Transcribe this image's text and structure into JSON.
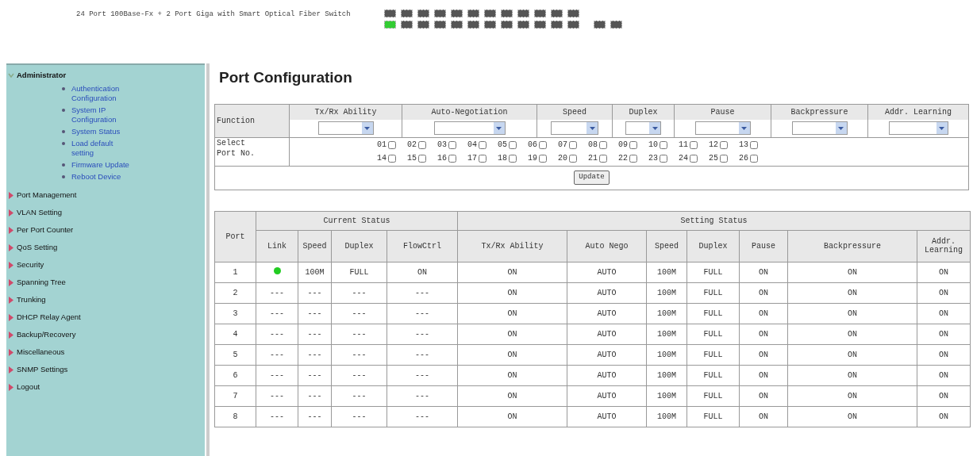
{
  "header": {
    "title": "24 Port 100Base-Fx + 2 Port Giga with Smart Optical Fiber Switch",
    "port_leds_top": [
      {
        "on": false
      },
      {
        "on": false
      },
      {
        "on": false
      },
      {
        "on": false
      },
      {
        "on": false
      },
      {
        "on": false
      },
      {
        "on": false
      },
      {
        "on": false
      },
      {
        "on": false
      },
      {
        "on": false
      },
      {
        "on": false
      },
      {
        "on": false
      }
    ],
    "port_leds_bottom": [
      {
        "on": true
      },
      {
        "on": false
      },
      {
        "on": false
      },
      {
        "on": false
      },
      {
        "on": false
      },
      {
        "on": false
      },
      {
        "on": false
      },
      {
        "on": false
      },
      {
        "on": false
      },
      {
        "on": false
      },
      {
        "on": false
      },
      {
        "on": false
      }
    ],
    "uplink_leds": [
      {
        "on": false
      },
      {
        "on": false
      }
    ]
  },
  "sidebar": {
    "items": [
      {
        "label": "Administrator",
        "expanded": true,
        "children": [
          {
            "label": "Authentication Configuration"
          },
          {
            "label": "System IP Configuration"
          },
          {
            "label": "System Status"
          },
          {
            "label": "Load default setting"
          },
          {
            "label": "Firmware Update"
          },
          {
            "label": "Reboot Device"
          }
        ]
      },
      {
        "label": "Port Management",
        "expanded": false
      },
      {
        "label": "VLAN Setting",
        "expanded": false
      },
      {
        "label": "Per Port Counter",
        "expanded": false
      },
      {
        "label": "QoS Setting",
        "expanded": false
      },
      {
        "label": "Security",
        "expanded": false
      },
      {
        "label": "Spanning Tree",
        "expanded": false
      },
      {
        "label": "Trunking",
        "expanded": false
      },
      {
        "label": "DHCP Relay Agent",
        "expanded": false
      },
      {
        "label": "Backup/Recovery",
        "expanded": false
      },
      {
        "label": "Miscellaneous",
        "expanded": false
      },
      {
        "label": "SNMP Settings",
        "expanded": false
      },
      {
        "label": "Logout",
        "expanded": false
      }
    ]
  },
  "page_title": "Port Configuration",
  "config": {
    "function_label": "Function",
    "columns": [
      "Tx/Rx Ability",
      "Auto-Negotiation",
      "Speed",
      "Duplex",
      "Pause",
      "Backpressure",
      "Addr. Learning"
    ],
    "select_label": "Select Port No.",
    "ports": [
      {
        "label": "01",
        "checked": false
      },
      {
        "label": "02",
        "checked": false
      },
      {
        "label": "03",
        "checked": false
      },
      {
        "label": "04",
        "checked": false
      },
      {
        "label": "05",
        "checked": false
      },
      {
        "label": "06",
        "checked": false
      },
      {
        "label": "07",
        "checked": false
      },
      {
        "label": "08",
        "checked": false
      },
      {
        "label": "09",
        "checked": false
      },
      {
        "label": "10",
        "checked": false
      },
      {
        "label": "11",
        "checked": false
      },
      {
        "label": "12",
        "checked": false
      },
      {
        "label": "13",
        "checked": false
      },
      {
        "label": "14",
        "checked": false
      },
      {
        "label": "15",
        "checked": false
      },
      {
        "label": "16",
        "checked": false
      },
      {
        "label": "17",
        "checked": false
      },
      {
        "label": "18",
        "checked": false
      },
      {
        "label": "19",
        "checked": false
      },
      {
        "label": "20",
        "checked": false
      },
      {
        "label": "21",
        "checked": false
      },
      {
        "label": "22",
        "checked": false
      },
      {
        "label": "23",
        "checked": false
      },
      {
        "label": "24",
        "checked": false
      },
      {
        "label": "25",
        "checked": false
      },
      {
        "label": "26",
        "checked": false
      }
    ],
    "update_button": "Update"
  },
  "status": {
    "port_header": "Port",
    "groups": [
      {
        "label": "Current Status",
        "columns": [
          "Link",
          "Speed",
          "Duplex",
          "FlowCtrl"
        ]
      },
      {
        "label": "Setting Status",
        "columns": [
          "Tx/Rx Ability",
          "Auto Nego",
          "Speed",
          "Duplex",
          "Pause",
          "Backpressure",
          "Addr. Learning"
        ]
      }
    ],
    "rows": [
      {
        "port": "1",
        "link_up": true,
        "current": [
          "100M",
          "FULL",
          "ON"
        ],
        "setting": [
          "ON",
          "AUTO",
          "100M",
          "FULL",
          "ON",
          "ON",
          "ON"
        ]
      },
      {
        "port": "2",
        "link_up": false,
        "link_text": "---",
        "current": [
          "---",
          "---",
          "---"
        ],
        "setting": [
          "ON",
          "AUTO",
          "100M",
          "FULL",
          "ON",
          "ON",
          "ON"
        ]
      },
      {
        "port": "3",
        "link_up": false,
        "link_text": "---",
        "current": [
          "---",
          "---",
          "---"
        ],
        "setting": [
          "ON",
          "AUTO",
          "100M",
          "FULL",
          "ON",
          "ON",
          "ON"
        ]
      },
      {
        "port": "4",
        "link_up": false,
        "link_text": "---",
        "current": [
          "---",
          "---",
          "---"
        ],
        "setting": [
          "ON",
          "AUTO",
          "100M",
          "FULL",
          "ON",
          "ON",
          "ON"
        ]
      },
      {
        "port": "5",
        "link_up": false,
        "link_text": "---",
        "current": [
          "---",
          "---",
          "---"
        ],
        "setting": [
          "ON",
          "AUTO",
          "100M",
          "FULL",
          "ON",
          "ON",
          "ON"
        ]
      },
      {
        "port": "6",
        "link_up": false,
        "link_text": "---",
        "current": [
          "---",
          "---",
          "---"
        ],
        "setting": [
          "ON",
          "AUTO",
          "100M",
          "FULL",
          "ON",
          "ON",
          "ON"
        ]
      },
      {
        "port": "7",
        "link_up": false,
        "link_text": "---",
        "current": [
          "---",
          "---",
          "---"
        ],
        "setting": [
          "ON",
          "AUTO",
          "100M",
          "FULL",
          "ON",
          "ON",
          "ON"
        ]
      },
      {
        "port": "8",
        "link_up": false,
        "link_text": "---",
        "current": [
          "---",
          "---",
          "---"
        ],
        "setting": [
          "ON",
          "AUTO",
          "100M",
          "FULL",
          "ON",
          "ON",
          "ON"
        ]
      }
    ]
  }
}
